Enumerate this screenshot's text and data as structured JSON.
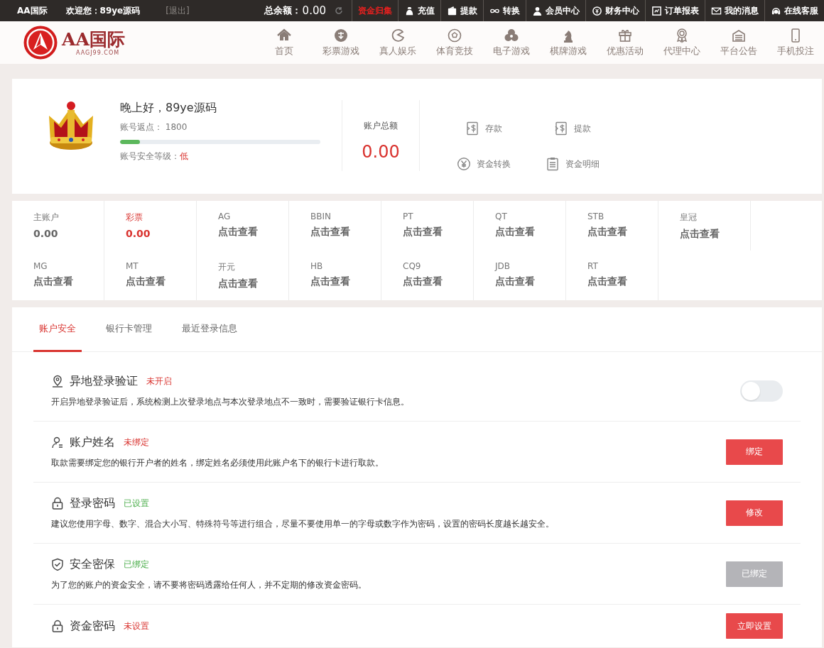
{
  "top_bar": {
    "site_name": "AA国际",
    "welcome": "欢迎您：89ye源码",
    "logout": "[退出]",
    "balance_label": "总余额：",
    "balance": "0.00",
    "items": [
      {
        "label": "资金归集",
        "kind": "highlight"
      },
      {
        "label": "充值",
        "kind": "link"
      },
      {
        "label": "提款",
        "kind": "link"
      },
      {
        "label": "转换",
        "kind": "link"
      },
      {
        "label": "会员中心",
        "kind": "link"
      },
      {
        "label": "财务中心",
        "kind": "link"
      },
      {
        "label": "订单报表",
        "kind": "link"
      },
      {
        "label": "我的消息",
        "kind": "link"
      },
      {
        "label": "在线客服",
        "kind": "link"
      }
    ]
  },
  "header": {
    "logo_text": "AA国际",
    "logo_domain": "AAGJ99.COM",
    "nav": [
      {
        "label": "首页"
      },
      {
        "label": "彩票游戏"
      },
      {
        "label": "真人娱乐"
      },
      {
        "label": "体育竞技"
      },
      {
        "label": "电子游戏"
      },
      {
        "label": "棋牌游戏"
      },
      {
        "label": "优惠活动"
      },
      {
        "label": "代理中心"
      },
      {
        "label": "平台公告"
      },
      {
        "label": "手机投注"
      }
    ]
  },
  "profile": {
    "greeting": "晚上好，89ye源码",
    "rebate": "账号返点： 1800",
    "level": 0.1,
    "security_label": "账号安全等级：",
    "security_value": "低",
    "total_label": "账户总额",
    "total": "0.00",
    "actions": [
      {
        "label": "存款"
      },
      {
        "label": "提款"
      },
      {
        "label": "资金转换"
      },
      {
        "label": "资金明细"
      }
    ]
  },
  "wallets": [
    {
      "name": "主账户",
      "value": "0.00",
      "selected": false
    },
    {
      "name": "彩票",
      "value": "0.00",
      "selected": true
    },
    {
      "name": "AG",
      "value": "点击查看",
      "selected": false
    },
    {
      "name": "BBIN",
      "value": "点击查看",
      "selected": false
    },
    {
      "name": "PT",
      "value": "点击查看",
      "selected": false
    },
    {
      "name": "QT",
      "value": "点击查看",
      "selected": false
    },
    {
      "name": "STB",
      "value": "点击查看",
      "selected": false
    },
    {
      "name": "皇冠",
      "value": "点击查看",
      "selected": false
    },
    {
      "name": "MG",
      "value": "点击查看",
      "selected": false
    },
    {
      "name": "MT",
      "value": "点击查看",
      "selected": false
    },
    {
      "name": "开元",
      "value": "点击查看",
      "selected": false
    },
    {
      "name": "HB",
      "value": "点击查看",
      "selected": false
    },
    {
      "name": "CQ9",
      "value": "点击查看",
      "selected": false
    },
    {
      "name": "JDB",
      "value": "点击查看",
      "selected": false
    },
    {
      "name": "RT",
      "value": "点击查看",
      "selected": false
    }
  ],
  "security": {
    "tabs": [
      {
        "label": "账户安全",
        "selected": true
      },
      {
        "label": "银行卡管理",
        "selected": false
      },
      {
        "label": "最近登录信息",
        "selected": false
      }
    ],
    "rows": [
      {
        "kind": "toggle",
        "title": "异地登录验证",
        "status": "未开启",
        "done": false,
        "description": "开启异地登录验证后，系统检测上次登录地点与本次登录地点不一致时，需要验证银行卡信息。",
        "on": false
      },
      {
        "kind": "button",
        "title": "账户姓名",
        "status": "未绑定",
        "done": false,
        "description": "取款需要绑定您的银行开户者的姓名，绑定姓名必须使用此账户名下的银行卡进行取款。",
        "button": "绑定",
        "disabled": false
      },
      {
        "kind": "button",
        "title": "登录密码",
        "status": "已设置",
        "done": true,
        "description": "建议您使用字母、数字、混合大小写、特殊符号等进行组合，尽量不要使用单一的字母或数字作为密码，设置的密码长度越长越安全。",
        "button": "修改",
        "disabled": false
      },
      {
        "kind": "button",
        "title": "安全密保",
        "status": "已绑定",
        "done": true,
        "description": "为了您的账户的资金安全，请不要将密码透露给任何人，并不定期的修改资金密码。",
        "button": "已绑定",
        "disabled": true
      },
      {
        "kind": "button",
        "title": "资金密码",
        "status": "未设置",
        "done": false,
        "button": "立即设置",
        "disabled": false
      }
    ]
  }
}
